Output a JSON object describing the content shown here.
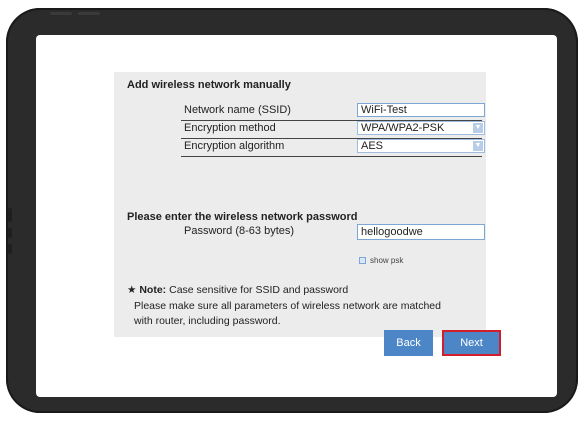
{
  "form": {
    "title": "Add wireless network manually",
    "ssid_label": "Network name (SSID)",
    "ssid_value": "WiFi-Test",
    "encryption_method_label": "Encryption method",
    "encryption_method_value": "WPA/WPA2-PSK",
    "encryption_algorithm_label": "Encryption algorithm",
    "encryption_algorithm_value": "AES",
    "password_section_title": "Please enter the wireless network password",
    "password_label": "Password (8-63 bytes)",
    "password_value": "hellogoodwe",
    "show_psk_label": "show psk"
  },
  "note": {
    "star": "★",
    "prefix": "Note:",
    "line1": " Case sensitive for SSID and password",
    "line2": "Please make sure all parameters of wireless network are matched",
    "line3": "with router, including password."
  },
  "buttons": {
    "back": "Back",
    "next": "Next"
  },
  "icons": {
    "dropdown": "chevron-down-icon",
    "checkbox": "checkbox-icon"
  },
  "colors": {
    "button_blue": "#4d86c6",
    "highlight_red": "#d21e2b",
    "panel_gray": "#ececec",
    "device_frame": "#2b2b2b"
  }
}
